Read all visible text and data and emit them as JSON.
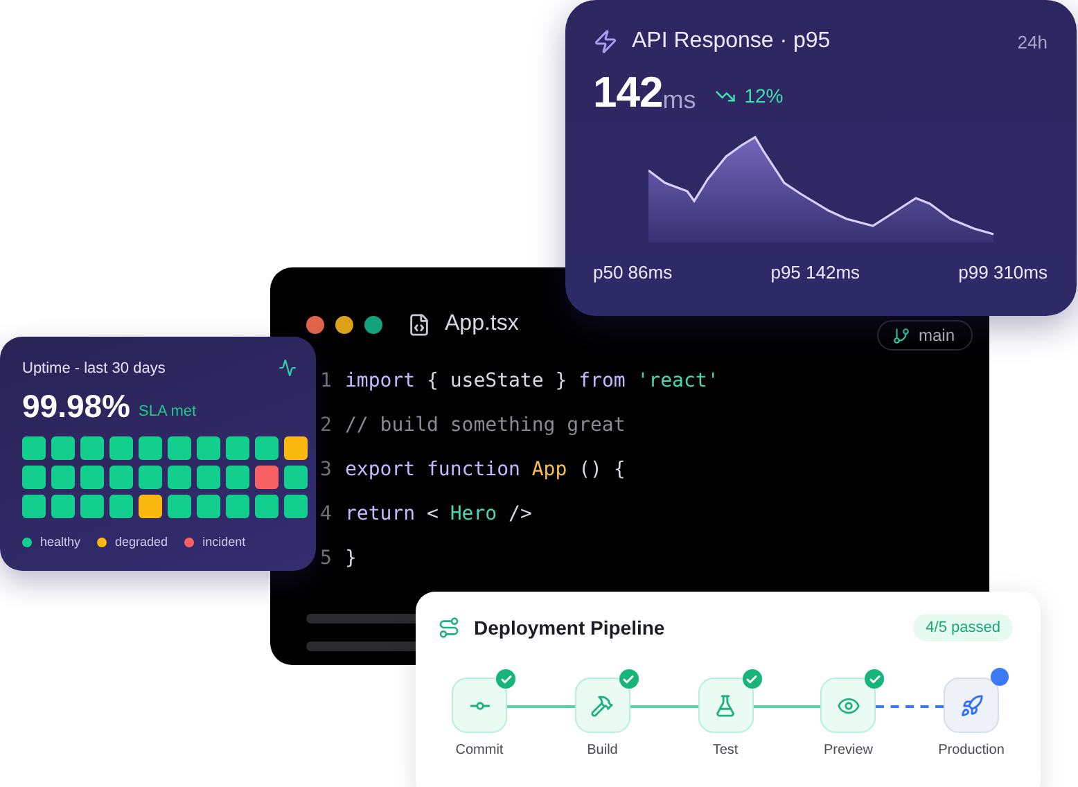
{
  "editor": {
    "file_name": "App.tsx",
    "branch": "main",
    "lines": [
      {
        "number": "1",
        "tokens": [
          {
            "kind": "keyword",
            "text": "import"
          },
          {
            "kind": "plain",
            "text": " { useState } "
          },
          {
            "kind": "keyword",
            "text": "from"
          },
          {
            "kind": "string",
            "text": " 'react'"
          }
        ]
      },
      {
        "number": "2",
        "tokens": [
          {
            "kind": "comment",
            "text": "// build something great"
          }
        ]
      },
      {
        "number": "3",
        "tokens": [
          {
            "kind": "keyword",
            "text": "export function"
          },
          {
            "kind": "func",
            "text": " App"
          },
          {
            "kind": "plain",
            "text": " () {"
          }
        ]
      },
      {
        "number": "4",
        "tokens": [
          {
            "kind": "keyword",
            "text": "return"
          },
          {
            "kind": "plain",
            "text": " < "
          },
          {
            "kind": "tag",
            "text": "Hero"
          },
          {
            "kind": "plain",
            "text": " />"
          }
        ]
      },
      {
        "number": "5",
        "tokens": [
          {
            "kind": "plain",
            "text": "}"
          }
        ]
      }
    ]
  },
  "api_card": {
    "title": "API Response · p95",
    "range": "24h",
    "value": "142",
    "unit": "ms",
    "trend": "12%",
    "percentiles": [
      "p50 86ms",
      "p95 142ms",
      "p99 310ms"
    ]
  },
  "uptime_card": {
    "title": "Uptime - last 30 days",
    "value": "99.98%",
    "note": "SLA met",
    "cells": [
      {
        "color": "#13cf8e"
      },
      {
        "color": "#13cf8e"
      },
      {
        "color": "#13cf8e"
      },
      {
        "color": "#13cf8e"
      },
      {
        "color": "#13cf8e"
      },
      {
        "color": "#13cf8e"
      },
      {
        "color": "#13cf8e"
      },
      {
        "color": "#13cf8e"
      },
      {
        "color": "#13cf8e"
      },
      {
        "color": "#fbb80f"
      },
      {
        "color": "#13cf8e"
      },
      {
        "color": "#13cf8e"
      },
      {
        "color": "#13cf8e"
      },
      {
        "color": "#13cf8e"
      },
      {
        "color": "#13cf8e"
      },
      {
        "color": "#13cf8e"
      },
      {
        "color": "#13cf8e"
      },
      {
        "color": "#13cf8e"
      },
      {
        "color": "#f86163"
      },
      {
        "color": "#13cf8e"
      },
      {
        "color": "#13cf8e"
      },
      {
        "color": "#13cf8e"
      },
      {
        "color": "#13cf8e"
      },
      {
        "color": "#13cf8e"
      },
      {
        "color": "#fbb80f"
      },
      {
        "color": "#13cf8e"
      },
      {
        "color": "#13cf8e"
      },
      {
        "color": "#13cf8e"
      },
      {
        "color": "#13cf8e"
      },
      {
        "color": "#13cf8e"
      }
    ],
    "legend": [
      {
        "label": "healthy",
        "color": "#13cf8e"
      },
      {
        "label": "degraded",
        "color": "#fbb80f"
      },
      {
        "label": "incident",
        "color": "#f86163"
      }
    ]
  },
  "pipeline": {
    "title": "Deployment Pipeline",
    "badge": "4/5 passed",
    "steps": [
      {
        "label": "Commit",
        "kind": "commit",
        "done": true
      },
      {
        "label": "Build",
        "kind": "build",
        "done": true
      },
      {
        "label": "Test",
        "kind": "test",
        "done": true
      },
      {
        "label": "Preview",
        "kind": "preview",
        "done": true
      },
      {
        "label": "Production",
        "kind": "deploy",
        "done": false
      }
    ]
  }
}
